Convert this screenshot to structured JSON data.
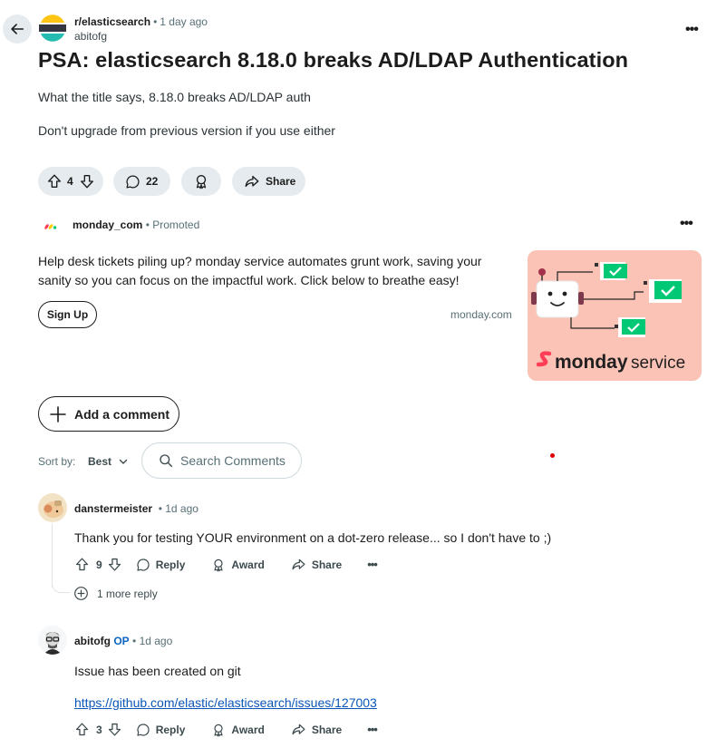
{
  "header": {
    "subreddit": "r/elasticsearch",
    "post_age": "1 day ago",
    "author": "abitofg",
    "more": "•••"
  },
  "post": {
    "title": "PSA: elasticsearch 8.18.0 breaks AD/LDAP Authentication",
    "body": [
      "What the title says, 8.18.0 breaks AD/LDAP auth",
      "Don't upgrade from previous version if you use either"
    ],
    "votes": "4",
    "comments": "22",
    "share_label": "Share"
  },
  "ad": {
    "advertiser": "monday_com",
    "promoted": "Promoted",
    "more": "•••",
    "text": "Help desk tickets piling up? monday service automates grunt work, saving your sanity so you can focus on the impactful work. Click below to breathe easy!",
    "cta": "Sign Up",
    "domain": "monday.com",
    "image_brand": "monday",
    "image_product": "service",
    "image_bg": "#fbc3b6",
    "check_color": "#00c875"
  },
  "comment_bar": {
    "add_comment": "Add a comment",
    "sort_label": "Sort by:",
    "sort_value": "Best",
    "search_placeholder": "Search Comments"
  },
  "comments": [
    {
      "author": "danstermeister",
      "op": "",
      "age": "1d ago",
      "text": "Thank you for testing YOUR environment on a dot-zero release... so I don't have to ;)",
      "votes": "9",
      "reply": "Reply",
      "award": "Award",
      "share": "Share",
      "more": "•••",
      "more_replies": "1 more reply"
    },
    {
      "author": "abitofg",
      "op": "OP",
      "age": "1d ago",
      "text": "Issue has been created on git",
      "link": "https://github.com/elastic/elasticsearch/issues/127003",
      "votes": "3",
      "reply": "Reply",
      "award": "Award",
      "share": "Share",
      "more": "•••"
    }
  ]
}
